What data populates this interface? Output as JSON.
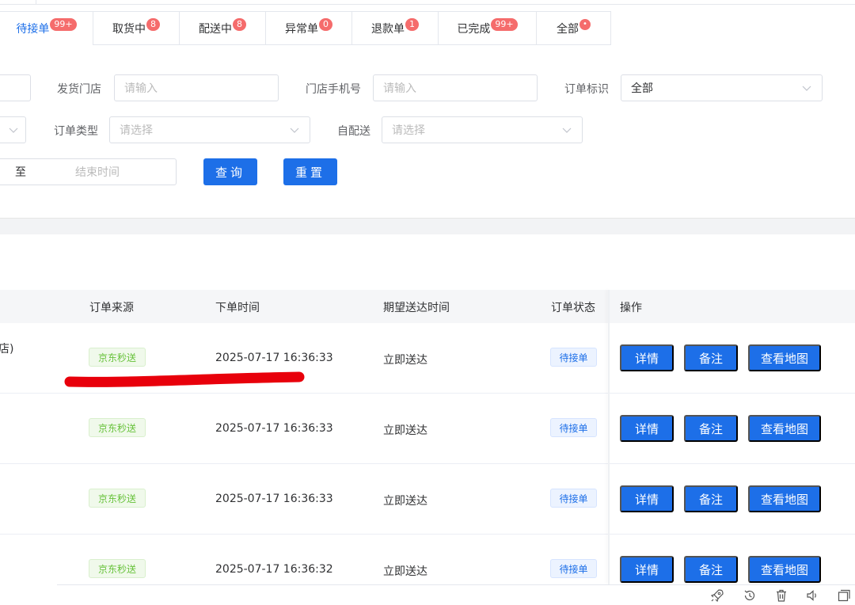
{
  "tabs": [
    {
      "label": "待接单",
      "badge": "99+"
    },
    {
      "label": "取货中",
      "badge": "8"
    },
    {
      "label": "配送中",
      "badge": "8"
    },
    {
      "label": "异常单",
      "badge": "0"
    },
    {
      "label": "退款单",
      "badge": "1"
    },
    {
      "label": "已完成",
      "badge": "99+"
    },
    {
      "label": "全部",
      "badge": "•"
    }
  ],
  "filters": {
    "ship_store_label": "发货门店",
    "ship_store_placeholder": "请输入",
    "store_phone_label": "门店手机号",
    "store_phone_placeholder": "请输入",
    "order_flag_label": "订单标识",
    "order_flag_value": "全部",
    "order_type_label": "订单类型",
    "order_type_placeholder": "请选择",
    "self_delivery_label": "自配送",
    "self_delivery_placeholder": "请选择",
    "date_sep": "至",
    "end_time_placeholder": "结束时间",
    "query_label": "查询",
    "reset_label": "重置"
  },
  "table": {
    "columns": [
      "订单来源",
      "下单时间",
      "期望送达时间",
      "订单状态",
      "操作"
    ],
    "partial_first_cell": "店)",
    "rows": [
      {
        "source": "京东秒送",
        "order_time": "2025-07-17 16:36:33",
        "expected": "立即送达",
        "status": "待接单"
      },
      {
        "source": "京东秒送",
        "order_time": "2025-07-17 16:36:33",
        "expected": "立即送达",
        "status": "待接单"
      },
      {
        "source": "京东秒送",
        "order_time": "2025-07-17 16:36:33",
        "expected": "立即送达",
        "status": "待接单"
      },
      {
        "source": "京东秒送",
        "order_time": "2025-07-17 16:36:32",
        "expected": "立即送达",
        "status": "待接单"
      }
    ],
    "actions": {
      "detail": "详情",
      "remark": "备注",
      "map": "查看地图"
    }
  },
  "colors": {
    "primary": "#1d6fe8",
    "badge": "#f56c6c",
    "tag_green": "#67c23a",
    "annotation": "#e8000b"
  }
}
